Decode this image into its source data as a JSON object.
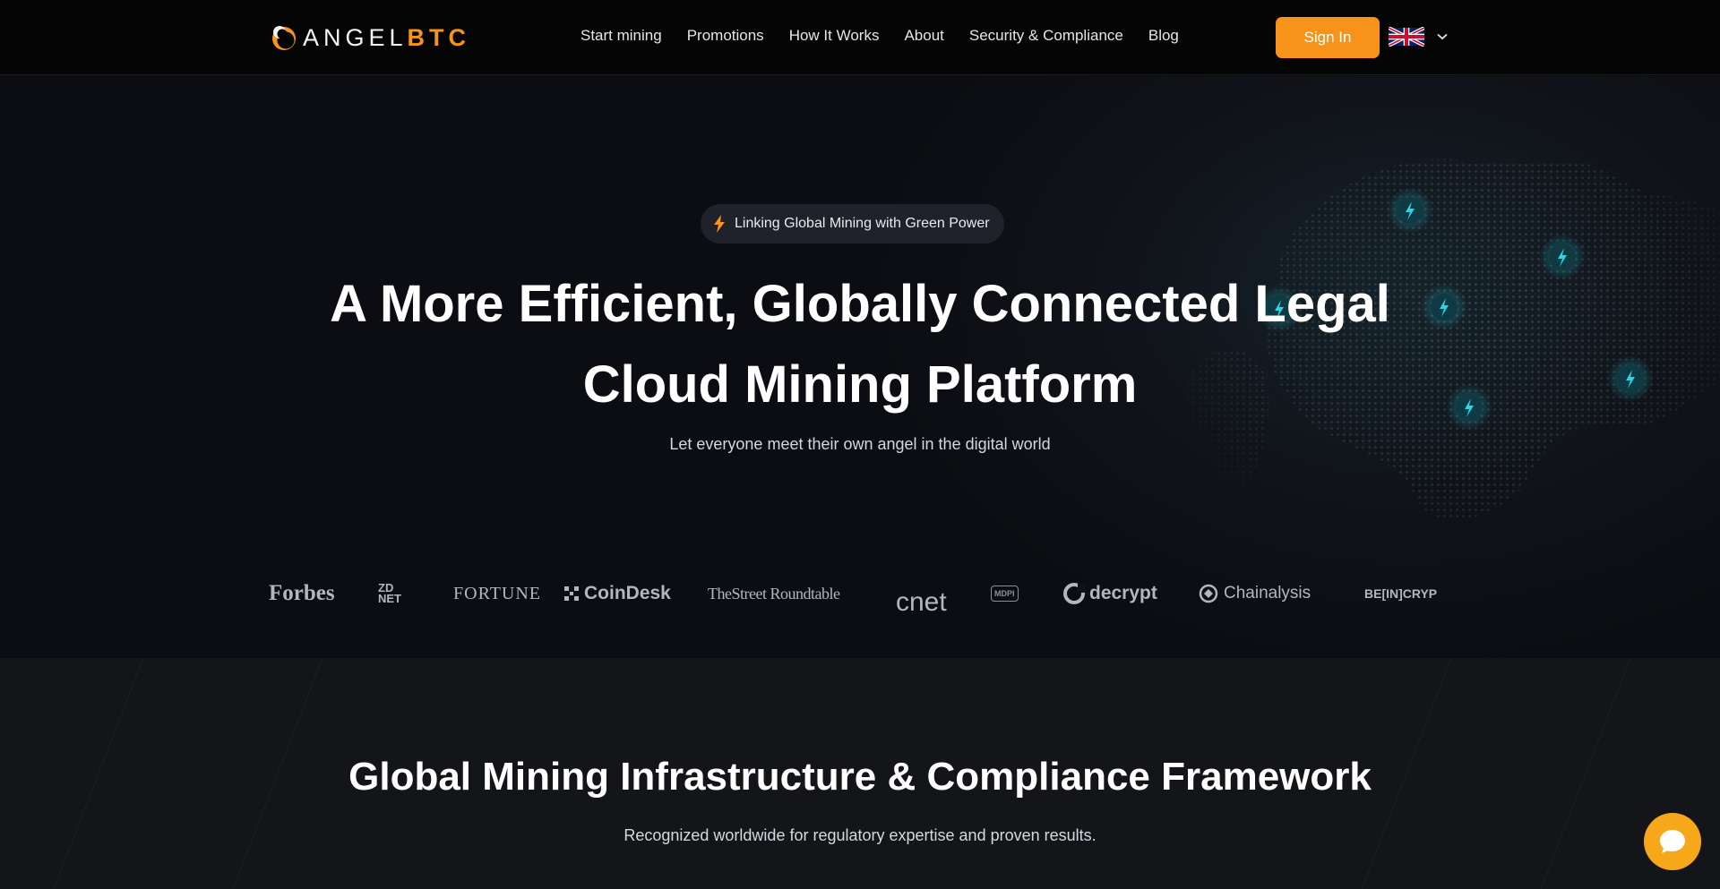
{
  "header": {
    "logo_light": "ANGEL",
    "logo_accent": "BTC",
    "nav": [
      {
        "label": "Start mining"
      },
      {
        "label": "Promotions"
      },
      {
        "label": "How It Works"
      },
      {
        "label": "About"
      },
      {
        "label": "Security & Compliance"
      },
      {
        "label": "Blog"
      }
    ],
    "sign_in": "Sign In",
    "language_icon": "uk-flag-icon"
  },
  "hero": {
    "badge": "Linking Global Mining with Green Power",
    "title_line1": "A More Efficient, Globally Connected Legal",
    "title_line2": "Cloud Mining Platform",
    "subtitle": "Let everyone meet their own angel in the digital world"
  },
  "press_logos": [
    "Forbes",
    "ZD NET",
    "FORTUNE",
    "CoinDesk",
    "TheStreet Roundtable",
    "cnet",
    "MDPI",
    "decrypt",
    "Chainalysis",
    "BE[IN]CRYP"
  ],
  "section2": {
    "title": "Global Mining Infrastructure & Compliance Framework",
    "subtitle": "Recognized worldwide for regulatory expertise and proven results."
  },
  "colors": {
    "accent": "#f7931a",
    "background": "#0c0d11",
    "lightning_node": "#1fb5c8"
  }
}
